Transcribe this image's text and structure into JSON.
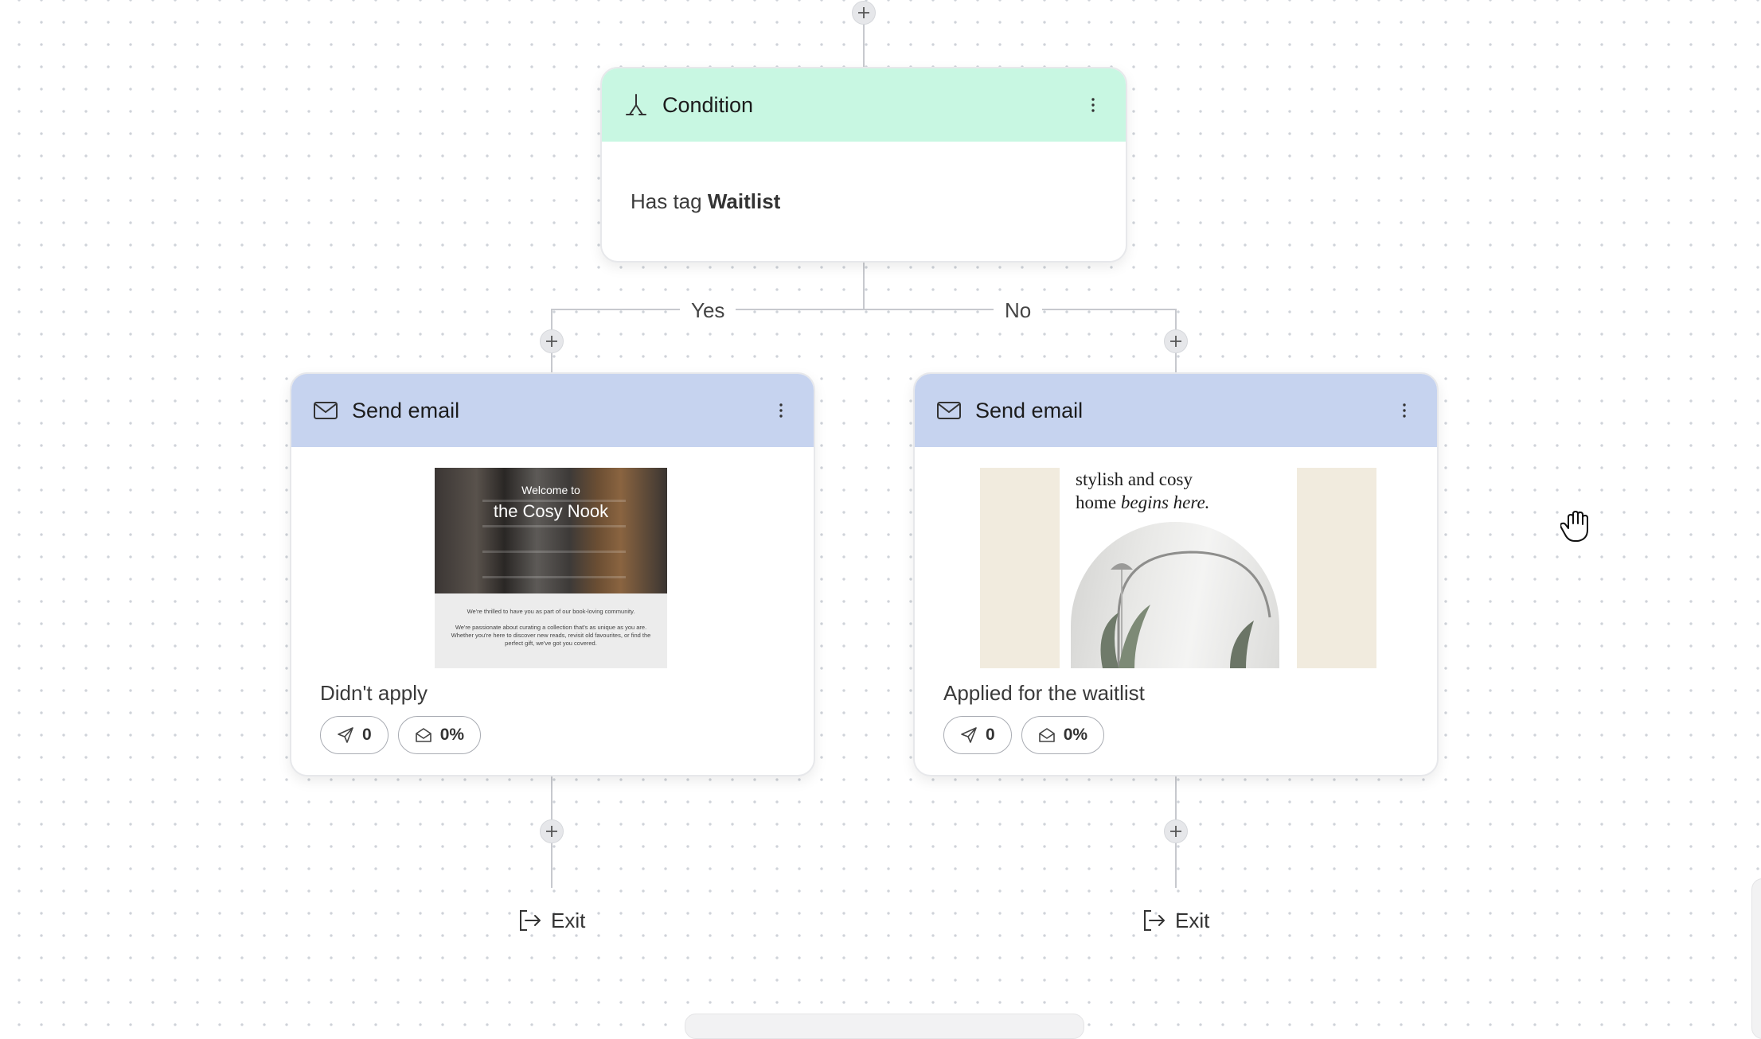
{
  "condition": {
    "title": "Condition",
    "body_prefix": "Has tag",
    "tag": "Waitlist",
    "yes_label": "Yes",
    "no_label": "No",
    "icon": "split-branch-icon"
  },
  "branches": [
    {
      "title": "Send email",
      "icon": "envelope-icon",
      "thumbnail": {
        "small_heading": "Welcome to",
        "big_heading": "the Cosy Nook",
        "line1": "We're thrilled to have you as part of our book-loving community.",
        "line2": "We're passionate about curating a collection that's as unique as you are. Whether you're here to discover new reads, revisit old favourites, or find the perfect gift, we've got you covered."
      },
      "email_name": "Didn't apply",
      "sent_count": "0",
      "open_rate": "0%",
      "exit_label": "Exit"
    },
    {
      "title": "Send email",
      "icon": "envelope-icon",
      "thumbnail": {
        "heading_line1": "stylish and cosy",
        "heading_line2_plain": "home ",
        "heading_line2_italic": "begins here."
      },
      "email_name": "Applied for the waitlist",
      "sent_count": "0",
      "open_rate": "0%",
      "exit_label": "Exit"
    }
  ],
  "colors": {
    "condition_header": "#c8f7e2",
    "email_header": "#c6d3ef",
    "connector": "#c7c9ce"
  }
}
